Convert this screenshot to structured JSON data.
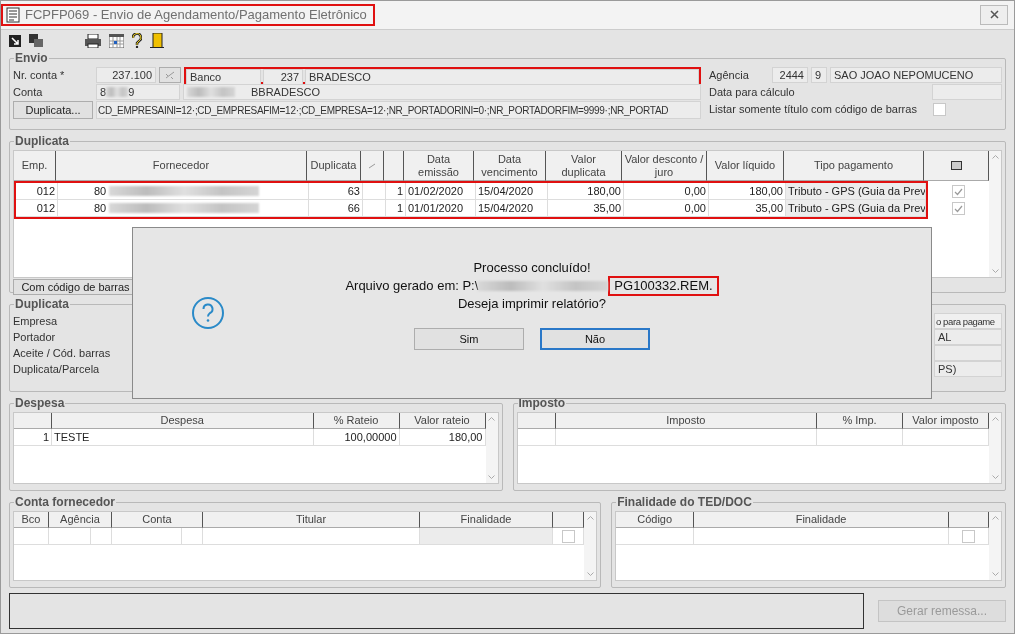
{
  "window": {
    "title": "FCPFP069 - Envio de Agendamento/Pagamento Eletrônico"
  },
  "envio": {
    "legend": "Envio",
    "nr_conta": {
      "label": "Nr. conta *",
      "value": "237.100"
    },
    "banco": {
      "label": "Banco",
      "code": "237",
      "name": "BRADESCO"
    },
    "conta": {
      "label": "Conta",
      "value_start": "8",
      "value_end": "9",
      "name": "BBRADESCO"
    },
    "duplicata_button": "Duplicata...",
    "filter": "CD_EMPRESAINI=12·;CD_EMPRESAFIM=12·;CD_EMPRESA=12·;NR_PORTADORINI=0·;NR_PORTADORFIM=9999·;NR_PORTAD",
    "agencia": {
      "label": "Agência",
      "code": "2444",
      "digit": "9",
      "name": "SAO JOAO NEPOMUCENO"
    },
    "data_calculo": {
      "label": "Data para cálculo"
    },
    "listar": {
      "label": "Listar somente título com código de barras",
      "checked": false
    }
  },
  "duplicata": {
    "legend": "Duplicata",
    "columns": [
      "Emp.",
      "Fornecedor",
      "Duplicata",
      "Data emissão",
      "Data vencimento",
      "Valor duplicata",
      "Valor desconto / juro",
      "Valor líquido",
      "Tipo pagamento"
    ],
    "rows": [
      {
        "emp": "012",
        "fornecedor": "80",
        "duplicata": "63",
        "parcela": "1",
        "emissao": "01/02/2020",
        "vencimento": "15/04/2020",
        "valor": "180,00",
        "desconto": "0,00",
        "liquido": "180,00",
        "tipo": "Tributo - GPS (Guia da Prev",
        "checked": true
      },
      {
        "emp": "012",
        "fornecedor": "80",
        "duplicata": "66",
        "parcela": "1",
        "emissao": "01/01/2020",
        "vencimento": "15/04/2020",
        "valor": "35,00",
        "desconto": "0,00",
        "liquido": "35,00",
        "tipo": "Tributo - GPS (Guia da Prev",
        "checked": true
      }
    ],
    "barcode_button": "Com código de barras"
  },
  "detalhe": {
    "legend": "Duplicata",
    "labels": [
      "Empresa",
      "Portador",
      "Aceite / Cód. barras",
      "Duplicata/Parcela"
    ],
    "right_header": "o para pagame",
    "right_line_1": "AL",
    "right_line_3": "PS)"
  },
  "despesa": {
    "legend": "Despesa",
    "columns": [
      "Despesa",
      "% Rateio",
      "Valor rateio"
    ],
    "rows": [
      {
        "index": "1",
        "despesa": "TESTE",
        "rateio": "100,00000",
        "valor": "180,00"
      }
    ]
  },
  "imposto": {
    "legend": "Imposto",
    "columns": [
      "Imposto",
      "% Imp.",
      "Valor imposto"
    ]
  },
  "conta_fornecedor": {
    "legend": "Conta fornecedor",
    "columns": [
      "Bco",
      "Agência",
      "Conta",
      "Titular",
      "Finalidade"
    ],
    "checked": false
  },
  "finalidade": {
    "legend": "Finalidade do TED/DOC",
    "columns": [
      "Código",
      "Finalidade"
    ],
    "checked": false
  },
  "footer": {
    "gerar_button": {
      "label": "Gerar remessa...",
      "disabled": true
    }
  },
  "dialog": {
    "title_line": "Processo concluído!",
    "path_label": "Arquivo gerado em: P:\\",
    "file": "PG100332.REM.",
    "question": "Deseja imprimir relatório?",
    "buttons": [
      {
        "label": "Sim",
        "selected": false
      },
      {
        "label": "Não",
        "selected": true
      }
    ]
  }
}
